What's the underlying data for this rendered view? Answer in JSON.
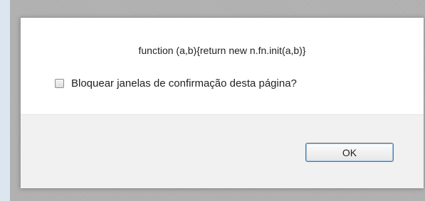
{
  "dialog": {
    "message": "function (a,b){return new n.fn.init(a,b)}",
    "checkbox": {
      "label": "Bloquear janelas de confirmação desta página?",
      "checked": false
    },
    "ok_label": "OK"
  },
  "colors": {
    "overlay": "#b3b3b3",
    "page_background": "#dde8f3",
    "dialog_background": "#ffffff",
    "footer_background": "#f1f1f1",
    "button_focus_ring": "#9cc2e5"
  }
}
